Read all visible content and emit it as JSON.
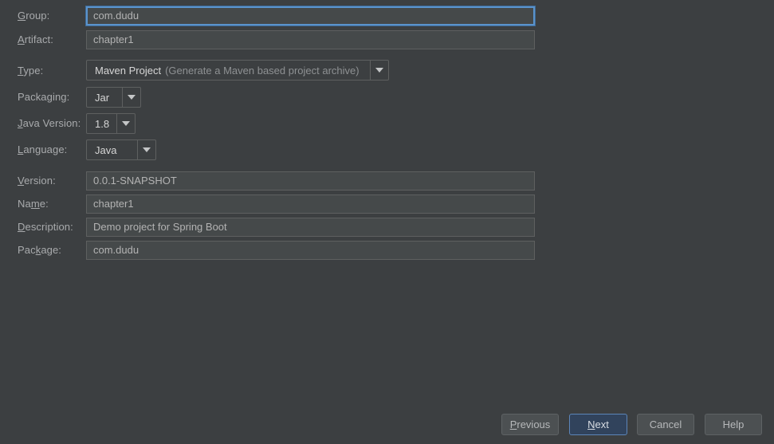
{
  "dialog": {
    "theme": {
      "background": "#3c3f41",
      "field_background": "#45494a",
      "field_border": "#5e6060",
      "focus_border": "#5a93cc",
      "text": "#a9abad",
      "value_text": "#b3b3b3",
      "default_button_background": "#31435c",
      "default_button_border": "#5c85b8"
    },
    "fields": [
      {
        "id": "group",
        "label": "Group:",
        "mnemonic": "G",
        "control": "text",
        "value": "com.dudu",
        "focused": true
      },
      {
        "id": "artifact",
        "label": "Artifact:",
        "mnemonic": "A",
        "control": "text",
        "value": "chapter1",
        "focused": false
      },
      {
        "id": "type",
        "label": "Type:",
        "mnemonic": "T",
        "control": "combo",
        "value": "Maven Project",
        "value_hint": "(Generate a Maven based project archive)"
      },
      {
        "id": "packaging",
        "label": "Packaging:",
        "mnemonic": "g",
        "control": "combo",
        "value": "Jar",
        "value_hint": ""
      },
      {
        "id": "java-version",
        "label": "Java Version:",
        "mnemonic": "J",
        "control": "combo",
        "value": "1.8",
        "value_hint": ""
      },
      {
        "id": "language",
        "label": "Language:",
        "mnemonic": "L",
        "control": "combo",
        "value": "Java",
        "value_hint": ""
      },
      {
        "id": "version",
        "label": "Version:",
        "mnemonic": "V",
        "control": "text",
        "value": "0.0.1-SNAPSHOT",
        "focused": false
      },
      {
        "id": "name",
        "label": "Name:",
        "mnemonic": "m",
        "control": "text",
        "value": "chapter1",
        "focused": false
      },
      {
        "id": "description",
        "label": "Description:",
        "mnemonic": "D",
        "control": "text",
        "value": "Demo project for Spring Boot",
        "focused": false
      },
      {
        "id": "package",
        "label": "Package:",
        "mnemonic": "k",
        "control": "text",
        "value": "com.dudu",
        "focused": false
      }
    ],
    "buttons": [
      {
        "id": "previous",
        "label": "Previous",
        "mnemonic": "P",
        "default": false
      },
      {
        "id": "next",
        "label": "Next",
        "mnemonic": "N",
        "default": true
      },
      {
        "id": "cancel",
        "label": "Cancel",
        "mnemonic": "",
        "default": false
      },
      {
        "id": "help",
        "label": "Help",
        "mnemonic": "",
        "default": false
      }
    ],
    "icons": {
      "dropdown_arrow": "chevron-down-icon"
    }
  }
}
